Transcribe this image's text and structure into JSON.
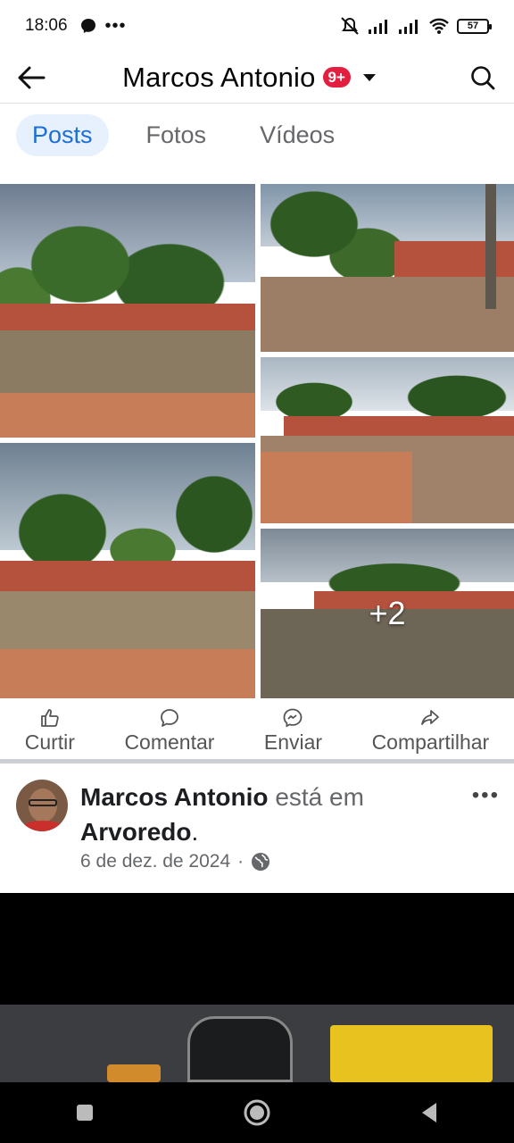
{
  "status_bar": {
    "time": "18:06",
    "battery": "57"
  },
  "header": {
    "title": "Marcos Antonio",
    "badge": "9+"
  },
  "tabs": [
    {
      "label": "Posts",
      "active": true
    },
    {
      "label": "Fotos",
      "active": false
    },
    {
      "label": "Vídeos",
      "active": false
    }
  ],
  "photo_grid": {
    "more_count": "+2"
  },
  "actions": [
    {
      "label": "Curtir",
      "icon": "like-icon"
    },
    {
      "label": "Comentar",
      "icon": "comment-icon"
    },
    {
      "label": "Enviar",
      "icon": "messenger-icon"
    },
    {
      "label": "Compartilhar",
      "icon": "share-icon"
    }
  ],
  "post": {
    "author": "Marcos Antonio",
    "verb": "está em",
    "place": "Arvoredo",
    "date": "6 de dez. de 2024",
    "privacy_icon": "globe-icon"
  },
  "colors": {
    "accent": "#1b6fd6",
    "badge": "#e41e3f",
    "muted": "#65676b"
  }
}
